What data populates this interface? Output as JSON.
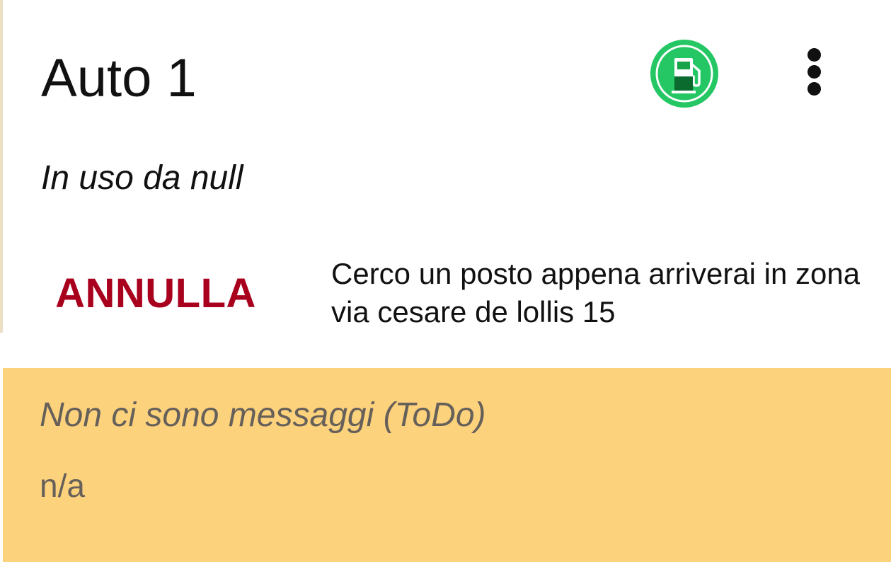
{
  "car": {
    "title": "Auto 1",
    "in_use_text": "In uso da null"
  },
  "header": {
    "status_icon": "fuel-pump-icon",
    "more_icon": "more-vertical-icon",
    "accent_color": "#24c764"
  },
  "action": {
    "cancel_label": "ANNULLA",
    "cancel_color": "#a8001d",
    "status_text": "Cerco un posto appena arriverai in zona via cesare de lollis 15"
  },
  "messages": {
    "empty_text": "Non ci sono messaggi (ToDo)",
    "meta_text": "n/a",
    "background_color": "#fdd27c"
  }
}
